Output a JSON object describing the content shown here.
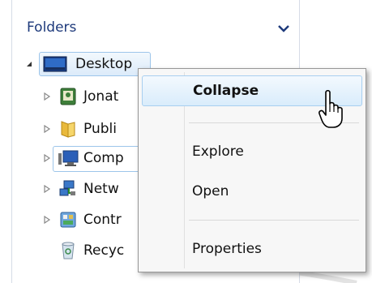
{
  "folders_pane": {
    "title": "Folders"
  },
  "tree": {
    "items": [
      {
        "label": "Desktop",
        "icon": "desktop-icon"
      },
      {
        "label": "Jonat",
        "icon": "user-folder-icon"
      },
      {
        "label": "Publi",
        "icon": "folder-icon"
      },
      {
        "label": "Comp",
        "icon": "computer-icon"
      },
      {
        "label": "Netw",
        "icon": "network-icon"
      },
      {
        "label": "Contr",
        "icon": "control-panel-icon"
      },
      {
        "label": "Recyc",
        "icon": "recycle-bin-icon"
      }
    ]
  },
  "context_menu": {
    "items": [
      {
        "label": "Collapse"
      },
      {
        "label": "Explore"
      },
      {
        "label": "Open"
      },
      {
        "label": "Properties"
      }
    ]
  },
  "colors": {
    "accent": "#1e3a7b",
    "highlight_border": "#a8cff0",
    "menu_background": "#f7f7f7"
  }
}
